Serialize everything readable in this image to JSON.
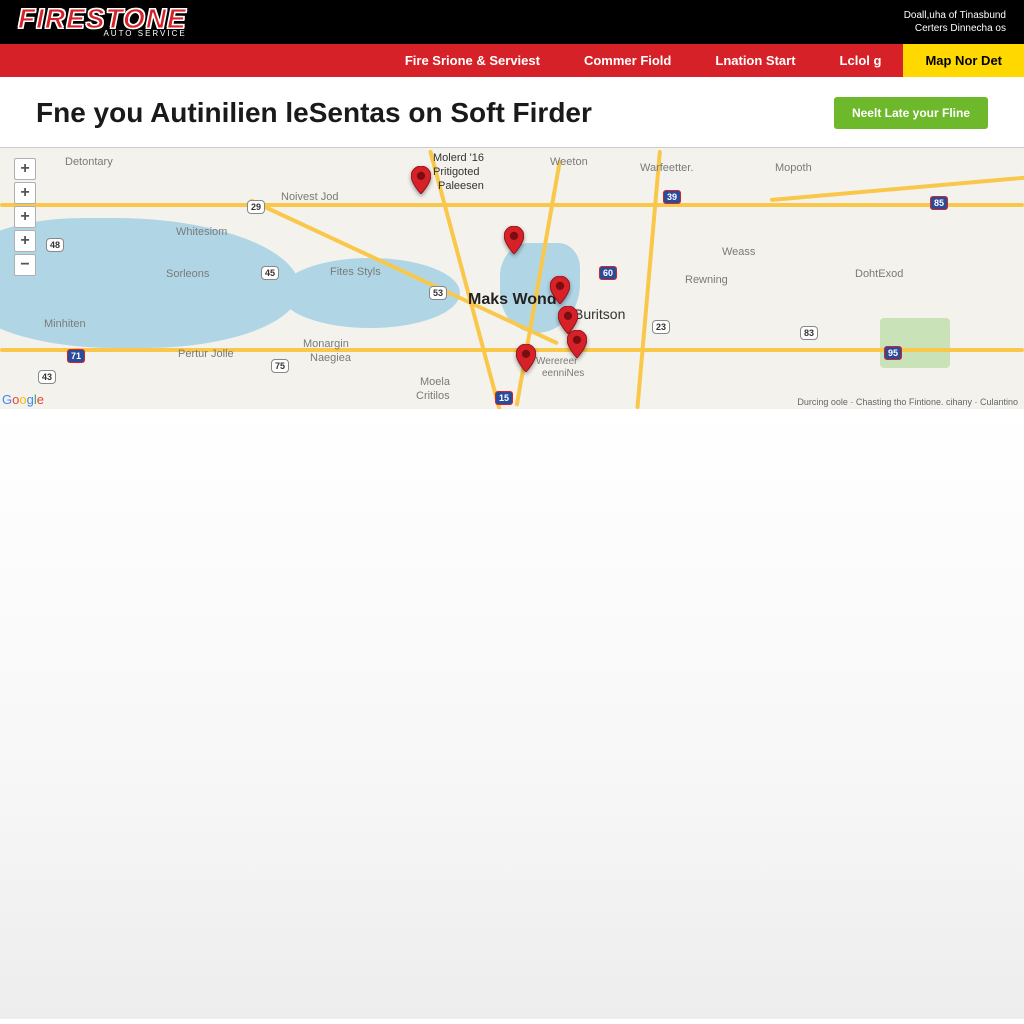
{
  "topbar": {
    "logo_main": "FIRESTONE",
    "logo_sub": "AUTO SERVICE",
    "right_line1": "Doall,uha of Tinasbund",
    "right_line2": "Certers Dinnecha os"
  },
  "nav": {
    "items": [
      {
        "label": "Fire Srione & Serviest"
      },
      {
        "label": "Commer Fiold"
      },
      {
        "label": "Lnation Start"
      },
      {
        "label": "Lclol g"
      },
      {
        "label": "Map Nor Det"
      }
    ]
  },
  "header": {
    "title": "Fne you Autinilien leSentas on Soft Firder",
    "button": "Neelt Late your Fline"
  },
  "map": {
    "controls": {
      "plus": "+",
      "minus": "−"
    },
    "attrib": "Durcing oole · Chasting tho  Fintione.  cihany · Culantino",
    "logo": "Google",
    "labels": {
      "detontary": "Detontary",
      "molerd": "Molerd '16",
      "pritigoted": "Pritigoted",
      "paleesen": "Paleesen",
      "weeton": "Weeton",
      "warfeetter": "Warfeetter.",
      "mopoth": "Mopoth",
      "noivest": "Noivest Jod",
      "whitesiom": "Whitesiom",
      "sorleons": "Sorleons",
      "fitesstyls": "Fites Styls",
      "maks": "Maks Wond",
      "buritson": "Buritson",
      "weass": "Weass",
      "rewning": "Rewning",
      "dohtexod": "DohtExod",
      "minhiten": "Minhiten",
      "pertur": "Pertur Jolle",
      "monargin": "Monargin",
      "naegiea": "Naegiea",
      "moela": "Moela",
      "critilos": "Critilos",
      "werereer": "Werereer",
      "eennines": "eenniNes"
    },
    "shields": {
      "s29": "29",
      "s39": "39",
      "s48": "48",
      "s45": "45",
      "s53": "53",
      "s60": "60",
      "s71": "71",
      "s75": "75",
      "s83": "83",
      "s85": "85",
      "s95": "95",
      "s15": "15",
      "s43": "43",
      "s23": "23"
    }
  }
}
